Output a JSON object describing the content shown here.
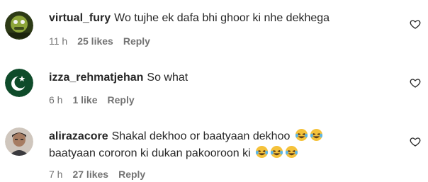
{
  "comments": [
    {
      "username": "virtual_fury",
      "text": "Wo tujhe ek dafa bhi ghoor ki nhe dekhega",
      "time": "11 h",
      "likes": "25 likes",
      "reply": "Reply"
    },
    {
      "username": "izza_rehmatjehan",
      "text": "So what",
      "time": "6 h",
      "likes": "1 like",
      "reply": "Reply"
    },
    {
      "username": "alirazacore",
      "text_line1": "Shakal dekhoo or baatyaan dekhoo",
      "text_line2": "baatyaan cororon ki dukan pakooroon ki",
      "emoji": "laughing-crying-face",
      "time": "7 h",
      "likes": "27 likes",
      "reply": "Reply"
    }
  ],
  "icons": {
    "like": "heart-outline-icon"
  },
  "colors": {
    "text": "#262626",
    "muted": "#737373",
    "emoji": "#f5c23b"
  }
}
